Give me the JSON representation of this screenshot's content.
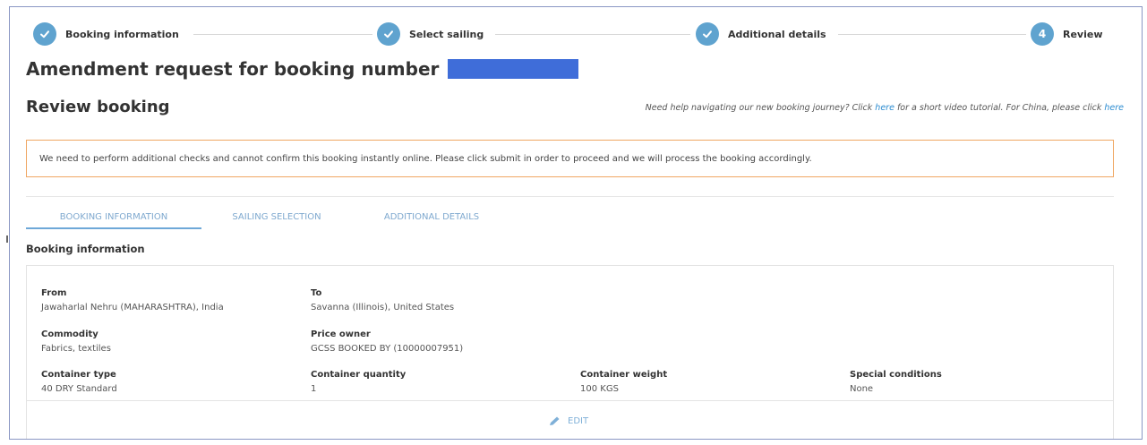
{
  "stepper": {
    "steps": [
      {
        "label": "Booking information",
        "state": "done"
      },
      {
        "label": "Select sailing",
        "state": "done"
      },
      {
        "label": "Additional details",
        "state": "done"
      },
      {
        "label": "Review",
        "number": "4",
        "state": "current"
      }
    ],
    "accent": "#5fa3cf"
  },
  "page": {
    "title": "Amendment request for booking number",
    "subtitle": "Review booking"
  },
  "help": {
    "text1": "Need help navigating our new booking journey? Click ",
    "link1": "here",
    "text2": " for a short video tutorial. For China, please click ",
    "link2": "here"
  },
  "notice": {
    "text": "We need to perform additional checks and cannot confirm this booking instantly online. Please click submit in order to proceed and we will process the booking accordingly.",
    "border_color": "#f0a763"
  },
  "tabs": [
    {
      "label": "BOOKING INFORMATION",
      "active": true
    },
    {
      "label": "SAILING SELECTION",
      "active": false
    },
    {
      "label": "ADDITIONAL DETAILS",
      "active": false
    }
  ],
  "booking": {
    "section_title": "Booking information",
    "from": {
      "label": "From",
      "value": "Jawaharlal Nehru (MAHARASHTRA), India"
    },
    "to": {
      "label": "To",
      "value": "Savanna (Illinois), United States"
    },
    "commodity": {
      "label": "Commodity",
      "value": "Fabrics, textiles"
    },
    "price_owner": {
      "label": "Price owner",
      "value": "GCSS BOOKED BY (10000007951)"
    },
    "container_type": {
      "label": "Container type",
      "value": "40 DRY Standard"
    },
    "container_quantity": {
      "label": "Container quantity",
      "value": "1"
    },
    "container_weight": {
      "label": "Container weight",
      "value": "100 KGS"
    },
    "special_conditions": {
      "label": "Special conditions",
      "value": "None"
    },
    "edit_label": "EDIT"
  }
}
